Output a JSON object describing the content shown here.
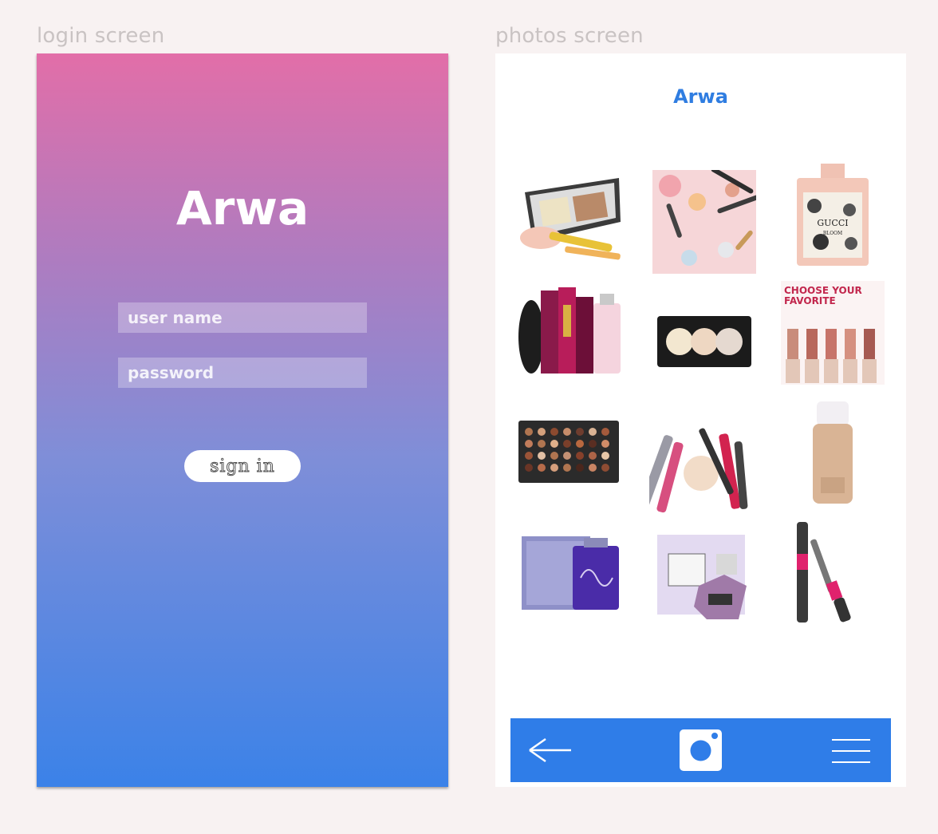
{
  "captions": {
    "login": "login screen",
    "photos": "photos screen"
  },
  "login": {
    "title": "Arwa",
    "username_placeholder": "user name",
    "password_placeholder": "password",
    "sign_in_label": "sign in",
    "gradient_top": "#e26ea8",
    "gradient_bottom": "#3b82e8"
  },
  "photos": {
    "title": "Arwa",
    "accent": "#2f7de1",
    "grid": [
      {
        "name": "eyeshadow-palette-photo"
      },
      {
        "name": "makeup-flatlay-photo"
      },
      {
        "name": "gucci-bloom-perfume-photo",
        "text": [
          "GUCCI",
          "BLOOM"
        ]
      },
      {
        "name": "perfume-bottles-photo"
      },
      {
        "name": "highlighter-palette-photo"
      },
      {
        "name": "lipstick-swatches-photo",
        "text": [
          "CHOOSE YOUR",
          "FAVORITE"
        ]
      },
      {
        "name": "eyeshadow-35-palette-photo"
      },
      {
        "name": "makeup-products-photo"
      },
      {
        "name": "foundation-bottle-photo"
      },
      {
        "name": "purple-perfume-box-photo"
      },
      {
        "name": "twilight-perfume-photo"
      },
      {
        "name": "mascara-photo"
      }
    ],
    "nav": {
      "back_icon": "arrow-left-icon",
      "camera_icon": "instagram-camera-icon",
      "menu_icon": "hamburger-menu-icon",
      "color": "#2f7de8"
    }
  }
}
